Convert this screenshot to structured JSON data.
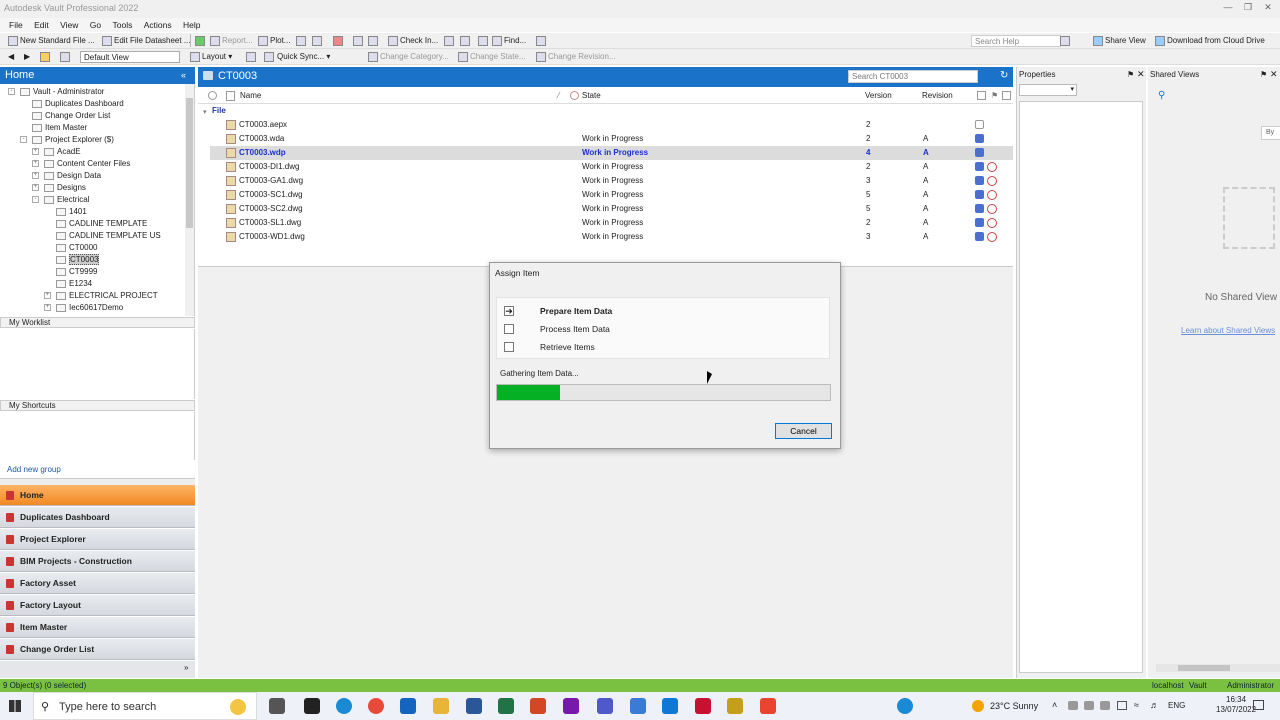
{
  "window": {
    "title": "Autodesk Vault Professional 2022"
  },
  "menu": [
    "File",
    "Edit",
    "View",
    "Go",
    "Tools",
    "Actions",
    "Help"
  ],
  "toolbar1": {
    "new_standard_file": "New Standard File ...",
    "edit_file_datasheet": "Edit File Datasheet ...",
    "report": "Report...",
    "plot": "Plot...",
    "check_in": "Check In...",
    "find": "Find...",
    "search_help_placeholder": "Search Help",
    "share_view": "Share View",
    "download_cloud": "Download from Cloud Drive"
  },
  "toolbar2": {
    "view_selected": "Default View",
    "layout": "Layout",
    "quick_sync": "Quick Sync...",
    "change_category": "Change Category...",
    "change_state": "Change State...",
    "change_revision": "Change Revision..."
  },
  "nav": {
    "title": "Home",
    "tree": [
      {
        "label": "Vault - Administrator",
        "level": 0,
        "expander": "-"
      },
      {
        "label": "Duplicates Dashboard",
        "level": 1
      },
      {
        "label": "Change Order List",
        "level": 1
      },
      {
        "label": "Item Master",
        "level": 1
      },
      {
        "label": "Project Explorer ($)",
        "level": 1,
        "expander": "-"
      },
      {
        "label": "AcadE",
        "level": 2,
        "expander": "+"
      },
      {
        "label": "Content Center Files",
        "level": 2,
        "expander": "+"
      },
      {
        "label": "Design Data",
        "level": 2,
        "expander": "+"
      },
      {
        "label": "Designs",
        "level": 2,
        "expander": "+"
      },
      {
        "label": "Electrical",
        "level": 2,
        "expander": "-"
      },
      {
        "label": "1401",
        "level": 3
      },
      {
        "label": "CADLINE TEMPLATE",
        "level": 3
      },
      {
        "label": "CADLINE TEMPLATE US",
        "level": 3
      },
      {
        "label": "CT0000",
        "level": 3
      },
      {
        "label": "CT0003",
        "level": 3,
        "selected": true
      },
      {
        "label": "CT9999",
        "level": 3
      },
      {
        "label": "E1234",
        "level": 3
      },
      {
        "label": "ELECTRICAL PROJECT",
        "level": 3,
        "expander": "+"
      },
      {
        "label": "Iec60617Demo",
        "level": 3,
        "expander": "+"
      }
    ],
    "my_worklist": "My Worklist",
    "my_shortcuts": "My Shortcuts",
    "add_new_group": "Add new group",
    "buttons": [
      {
        "label": "Home",
        "active": true
      },
      {
        "label": "Duplicates Dashboard"
      },
      {
        "label": "Project Explorer"
      },
      {
        "label": "BIM Projects - Construction"
      },
      {
        "label": "Factory Asset"
      },
      {
        "label": "Factory Layout"
      },
      {
        "label": "Item Master"
      },
      {
        "label": "Change Order List"
      }
    ]
  },
  "main": {
    "title": "CT0003",
    "search_placeholder": "Search CT0003",
    "columns": {
      "name": "Name",
      "state": "State",
      "version": "Version",
      "revision": "Revision"
    },
    "group_label": "File",
    "files": [
      {
        "name": "CT0003.aepx",
        "state": "",
        "version": "2",
        "revision": ""
      },
      {
        "name": "CT0003.wda",
        "state": "Work in Progress",
        "version": "2",
        "revision": "A"
      },
      {
        "name": "CT0003.wdp",
        "state": "Work in Progress",
        "version": "4",
        "revision": "A",
        "selected": true
      },
      {
        "name": "CT0003-DI1.dwg",
        "state": "Work in Progress",
        "version": "2",
        "revision": "A"
      },
      {
        "name": "CT0003-GA1.dwg",
        "state": "Work in Progress",
        "version": "3",
        "revision": "A"
      },
      {
        "name": "CT0003-SC1.dwg",
        "state": "Work in Progress",
        "version": "5",
        "revision": "A"
      },
      {
        "name": "CT0003-SC2.dwg",
        "state": "Work in Progress",
        "version": "5",
        "revision": "A"
      },
      {
        "name": "CT0003-SL1.dwg",
        "state": "Work in Progress",
        "version": "2",
        "revision": "A"
      },
      {
        "name": "CT0003-WD1.dwg",
        "state": "Work in Progress",
        "version": "3",
        "revision": "A"
      }
    ]
  },
  "properties": {
    "title": "Properties"
  },
  "shared_views": {
    "title": "Shared Views",
    "empty_text": "No Shared View",
    "learn_link": "Learn about Shared Views",
    "by": "By"
  },
  "dialog": {
    "title": "Assign Item",
    "steps": [
      {
        "label": "Prepare Item Data",
        "state": "active"
      },
      {
        "label": "Process Item Data",
        "state": "pending"
      },
      {
        "label": "Retrieve Items",
        "state": "pending"
      }
    ],
    "status_text": "Gathering Item Data...",
    "progress_percent": 19,
    "cancel_label": "Cancel"
  },
  "statusbar": {
    "left": "9 Object(s) (0 selected)",
    "server": "localhost",
    "vault": "Vault",
    "user": "Administrator"
  },
  "taskbar": {
    "search_placeholder": "Type here to search",
    "weather": "23°C  Sunny",
    "time": "16:34",
    "date": "13/07/2022"
  },
  "colors": {
    "accent_blue": "#1a73c9",
    "progress_green": "#06b025",
    "status_green": "#7ac142",
    "nav_active": "#f08a22"
  }
}
